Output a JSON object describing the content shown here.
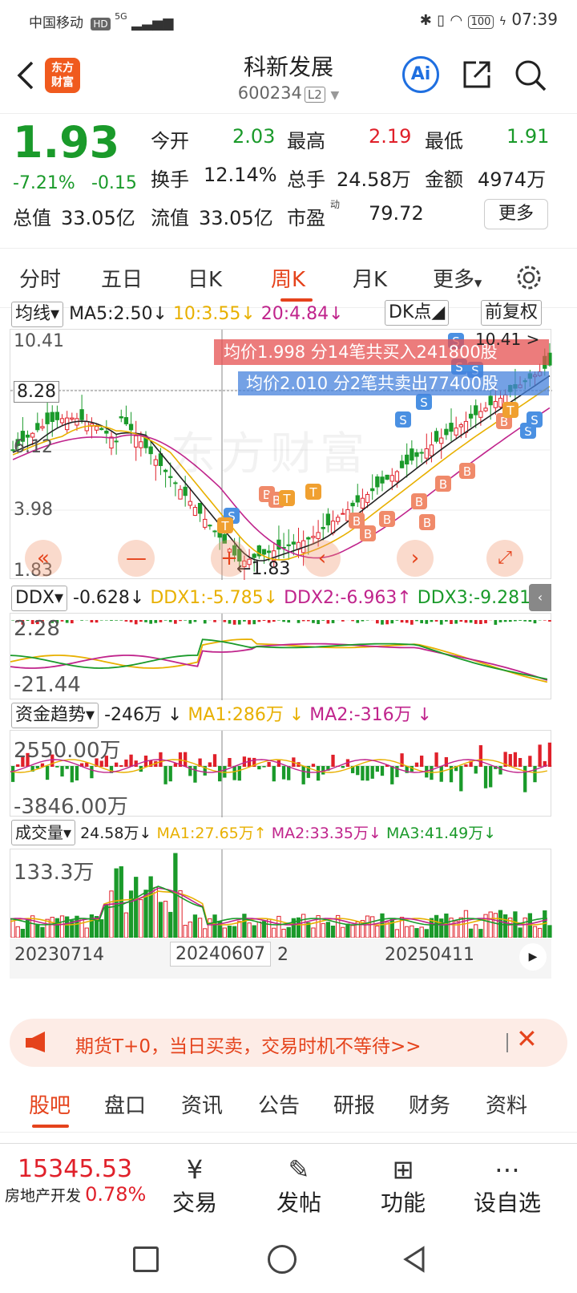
{
  "status_bar": {
    "carrier": "中国移动",
    "hd": "HD",
    "signal": "5G",
    "battery": "100",
    "time": "07:39"
  },
  "header": {
    "logo_top": "东方",
    "logo_bottom": "财富",
    "title": "科新发展",
    "code": "600234",
    "level": "L2",
    "ai": "Ai"
  },
  "quote": {
    "price": "1.93",
    "change_pct": "-7.21%",
    "change": "-0.15",
    "open_label": "今开",
    "open": "2.03",
    "high_label": "最高",
    "high": "2.19",
    "low_label": "最低",
    "low": "1.91",
    "turnover_label": "换手",
    "turnover": "12.14%",
    "volume_label": "总手",
    "volume": "24.58万",
    "amount_label": "金额",
    "amount": "4974万",
    "total_mv_label": "总值",
    "total_mv": "33.05亿",
    "float_mv_label": "流值",
    "float_mv": "33.05亿",
    "pe_label": "市盈",
    "pe_sup": "动",
    "pe": "79.72",
    "more": "更多"
  },
  "tabs": [
    "分时",
    "五日",
    "日K",
    "周K",
    "月K",
    "更多"
  ],
  "active_tab": "周K",
  "ma_bar": {
    "selector": "均线",
    "ma5": "MA5:2.50",
    "ma10": "10:3.55",
    "ma20": "20:4.84",
    "dk": "DK点",
    "adjust": "前复权"
  },
  "kline": {
    "price_labels": [
      "10.41",
      "8.28",
      "6.12",
      "3.98",
      "1.83"
    ],
    "high_marker": "10.41",
    "low_marker": "1.83",
    "buy_banner": "均价1.998  分14笔共买入241800股",
    "sell_banner": "均价2.010  分2笔共卖出77400股",
    "watermark": "东方财富"
  },
  "ddx": {
    "selector": "DDX",
    "value": "-0.628",
    "ddx1": "DDX1:-5.785",
    "ddx2": "DDX2:-6.963",
    "ddx3": "DDX3:-9.281",
    "top": "2.28",
    "bottom": "-21.44"
  },
  "fund": {
    "selector": "资金趋势",
    "value": "-246万",
    "ma1": "MA1:286万",
    "ma2": "MA2:-316万",
    "top": "2550.00万",
    "bottom": "-3846.00万"
  },
  "volume": {
    "selector": "成交量",
    "value": "24.58万",
    "ma1": "MA1:27.65万",
    "ma2": "MA2:33.35万",
    "ma3": "MA3:41.49万",
    "top": "133.3万"
  },
  "dates": {
    "d1": "20230714",
    "d2": "20240607",
    "d2_suffix": "2",
    "d3": "20250411"
  },
  "news": {
    "text": "期货T+0，当日买卖，交易时机不等待>>"
  },
  "sub_tabs": [
    "股吧",
    "盘口",
    "资讯",
    "公告",
    "研报",
    "财务",
    "资料"
  ],
  "bottom_bar": {
    "index_value": "15345.53",
    "index_name": "房地产开发",
    "index_pct": "0.78%",
    "items": [
      "交易",
      "发帖",
      "功能",
      "设自选"
    ]
  },
  "colors": {
    "accent": "#e5431c",
    "up": "#e0202a",
    "down": "#1a9a2a",
    "ma5": "#222222",
    "ma10": "#e8b000",
    "ma20": "#c0248c"
  }
}
